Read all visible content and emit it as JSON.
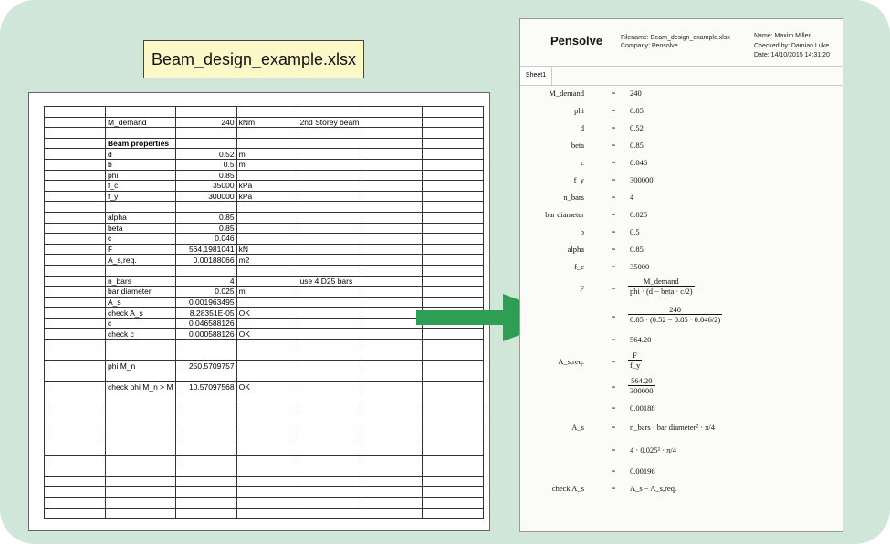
{
  "file_label": "Beam_design_example.xlsx",
  "spreadsheet": {
    "rows": [
      [
        "",
        "",
        "",
        "",
        "",
        "",
        "",
        ""
      ],
      [
        "",
        "M_demand",
        "240",
        "kNm",
        "2nd Storey beam",
        "",
        "",
        ""
      ],
      [
        "",
        "",
        "",
        "",
        "",
        "",
        "",
        ""
      ],
      [
        "",
        "Beam properties",
        "",
        "",
        "",
        "",
        "",
        ""
      ],
      [
        "",
        "d",
        "0.52",
        "m",
        "",
        "",
        "",
        ""
      ],
      [
        "",
        "b",
        "0.5",
        "m",
        "",
        "",
        "",
        ""
      ],
      [
        "",
        "phi",
        "0.85",
        "",
        "",
        "",
        "",
        ""
      ],
      [
        "",
        "f_c",
        "35000",
        "kPa",
        "",
        "",
        "",
        ""
      ],
      [
        "",
        "f_y",
        "300000",
        "kPa",
        "",
        "",
        "",
        ""
      ],
      [
        "",
        "",
        "",
        "",
        "",
        "",
        "",
        ""
      ],
      [
        "",
        "alpha",
        "0.85",
        "",
        "",
        "",
        "",
        ""
      ],
      [
        "",
        "beta",
        "0.85",
        "",
        "",
        "",
        "",
        ""
      ],
      [
        "",
        "c",
        "0.046",
        "",
        "",
        "",
        "",
        ""
      ],
      [
        "",
        "F",
        "564.1981041",
        "kN",
        "",
        "",
        "",
        ""
      ],
      [
        "",
        "A_s,req.",
        "0.00188066",
        "m2",
        "",
        "",
        "",
        ""
      ],
      [
        "",
        "",
        "",
        "",
        "",
        "",
        "",
        ""
      ],
      [
        "",
        "n_bars",
        "4",
        "",
        "use 4 D25 bars",
        "",
        "",
        ""
      ],
      [
        "",
        "bar diameter",
        "0.025",
        "m",
        "",
        "",
        "",
        ""
      ],
      [
        "",
        "A_s",
        "0.001963495",
        "",
        "",
        "",
        "",
        ""
      ],
      [
        "",
        "check A_s",
        "8.28351E-05",
        "OK",
        "",
        "",
        "",
        ""
      ],
      [
        "",
        "c",
        "0.046588126",
        "",
        "",
        "",
        "",
        ""
      ],
      [
        "",
        "check c",
        "0.000588126",
        "OK",
        "",
        "",
        "",
        ""
      ],
      [
        "",
        "",
        "",
        "",
        "",
        "",
        "",
        ""
      ],
      [
        "",
        "",
        "",
        "",
        "",
        "",
        "",
        ""
      ],
      [
        "",
        "phi M_n",
        "250.5709757",
        "",
        "",
        "",
        "",
        ""
      ],
      [
        "",
        "",
        "",
        "",
        "",
        "",
        "",
        ""
      ],
      [
        "",
        "check phi M_n > M",
        "10.57097568",
        "OK",
        "",
        "",
        "",
        ""
      ],
      [
        "",
        "",
        "",
        "",
        "",
        "",
        "",
        ""
      ],
      [
        "",
        "",
        "",
        "",
        "",
        "",
        "",
        ""
      ],
      [
        "",
        "",
        "",
        "",
        "",
        "",
        "",
        ""
      ],
      [
        "",
        "",
        "",
        "",
        "",
        "",
        "",
        ""
      ],
      [
        "",
        "",
        "",
        "",
        "",
        "",
        "",
        ""
      ],
      [
        "",
        "",
        "",
        "",
        "",
        "",
        "",
        ""
      ],
      [
        "",
        "",
        "",
        "",
        "",
        "",
        "",
        ""
      ],
      [
        "",
        "",
        "",
        "",
        "",
        "",
        "",
        ""
      ],
      [
        "",
        "",
        "",
        "",
        "",
        "",
        "",
        ""
      ],
      [
        "",
        "",
        "",
        "",
        "",
        "",
        "",
        ""
      ],
      [
        "",
        "",
        "",
        "",
        "",
        "",
        "",
        ""
      ],
      [
        "",
        "",
        "",
        "",
        "",
        "",
        "",
        ""
      ]
    ]
  },
  "report": {
    "brand": "Pensolve",
    "filename": "Filename: Beam_design_example.xlsx",
    "company": "Company: Pensolve",
    "name": "Name: Maxim Millen",
    "checked_by": "Checked by: Damian Luke",
    "date": "Date: 14/10/2015 14:31:20",
    "tab": "Sheet1",
    "eq": "=",
    "lines": [
      {
        "label": "M_demand",
        "value": "240"
      },
      {
        "label": "phi",
        "value": "0.85"
      },
      {
        "label": "d",
        "value": "0.52"
      },
      {
        "label": "beta",
        "value": "0.85"
      },
      {
        "label": "c",
        "value": "0.046"
      },
      {
        "label": "f_y",
        "value": "300000"
      },
      {
        "label": "n_bars",
        "value": "4"
      },
      {
        "label": "bar diameter",
        "value": "0.025"
      },
      {
        "label": "b",
        "value": "0.5"
      },
      {
        "label": "alpha",
        "value": "0.85"
      },
      {
        "label": "f_c",
        "value": "35000"
      }
    ],
    "F": {
      "label": "F",
      "sym_num": "M_demand",
      "sym_den": "phi · (d − beta · c/2)",
      "num_num": "240",
      "num_den": "0.85 · (0.52 − 0.85 · 0.046/2)",
      "result": "564.20"
    },
    "Asreq": {
      "label": "A_s,req.",
      "sym_num": "F",
      "sym_den": "f_y",
      "num_num": "564.20",
      "num_den": "300000",
      "result": "0.00188"
    },
    "As": {
      "label": "A_s",
      "sym": "n_bars · bar diameter² · π/4",
      "num": "4 · 0.025² · π/4",
      "result": "0.00196"
    },
    "check": {
      "label": "check A_s",
      "value": "A_s − A_s,req."
    }
  },
  "colors": {
    "background": "#cfe6d9",
    "label_fill": "#fdf8c8",
    "arrow": "#2e9e55"
  }
}
